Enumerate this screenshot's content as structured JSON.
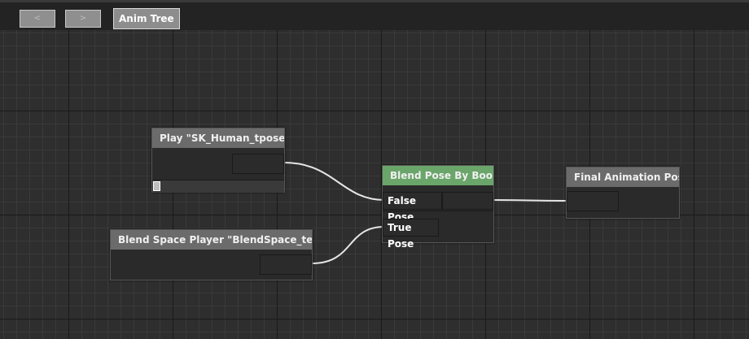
{
  "toolbar": {
    "back_label": "<",
    "forward_label": ">",
    "tab_label": "Anim Tree"
  },
  "nodes": {
    "play": {
      "title": "Play \"SK_Human_tpose\"",
      "progress": 0.0
    },
    "blend_space": {
      "title": "Blend Space Player \"BlendSpace_test\""
    },
    "blend_bool": {
      "title": "Blend Pose By Bool",
      "header_color": "#6aa56a",
      "false_pin": "False Pose",
      "true_pin": "True Pose"
    },
    "final": {
      "title": "Final Animation Pose"
    }
  },
  "colors": {
    "wire": "#e6e6e6",
    "node_header": "#6b6b6b"
  }
}
